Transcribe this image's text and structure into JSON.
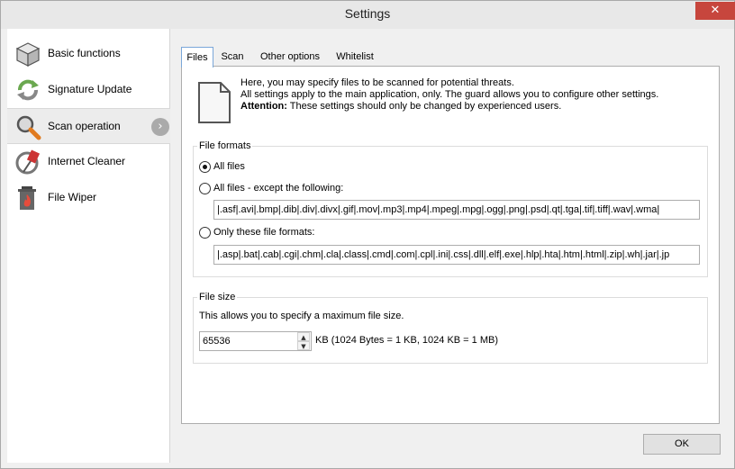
{
  "window": {
    "title": "Settings",
    "close_glyph": "✕"
  },
  "sidebar": {
    "items": [
      {
        "label": "Basic functions",
        "icon": "box-icon"
      },
      {
        "label": "Signature Update",
        "icon": "update-icon"
      },
      {
        "label": "Scan operation",
        "icon": "magnifier-icon",
        "active": true
      },
      {
        "label": "Internet Cleaner",
        "icon": "broom-icon"
      },
      {
        "label": "File Wiper",
        "icon": "trash-fire-icon"
      }
    ],
    "active_arrow": "›"
  },
  "tabs": [
    {
      "label": "Files",
      "active": true
    },
    {
      "label": "Scan"
    },
    {
      "label": "Other options"
    },
    {
      "label": "Whitelist"
    }
  ],
  "intro": {
    "line1": "Here, you may specify files to be scanned for potential threats.",
    "line2": "All settings apply to the main application, only. The guard allows you to configure other settings.",
    "attention_label": "Attention:",
    "attention_text": " These settings should only be changed by experienced users."
  },
  "file_formats": {
    "group_label": "File formats",
    "all_files": "All files",
    "all_except": "All files - except the following:",
    "except_value": "|.asf|.avi|.bmp|.dib|.div|.divx|.gif|.mov|.mp3|.mp4|.mpeg|.mpg|.ogg|.png|.psd|.qt|.tga|.tif|.tiff|.wav|.wma|",
    "only_these": "Only these file formats:",
    "only_value": "|.asp|.bat|.cab|.cgi|.chm|.cla|.class|.cmd|.com|.cpl|.ini|.css|.dll|.elf|.exe|.hlp|.hta|.htm|.html|.zip|.wh|.jar|.jp",
    "selected": "all_files"
  },
  "file_size": {
    "group_label": "File size",
    "description": "This allows you to specify a maximum file size.",
    "value": "65536",
    "unit_note": "KB (1024 Bytes = 1 KB, 1024 KB = 1 MB)",
    "up": "▲",
    "down": "▼"
  },
  "footer": {
    "ok_label": "OK"
  }
}
